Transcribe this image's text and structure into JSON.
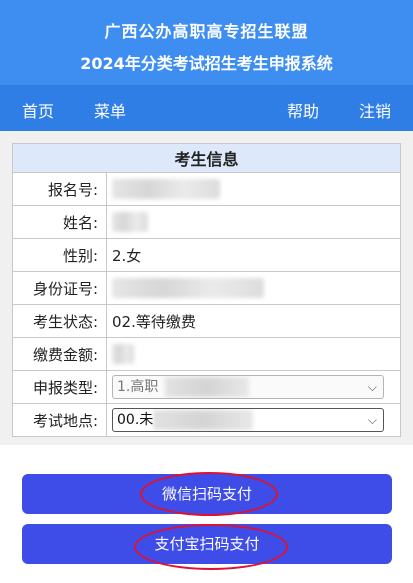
{
  "header": {
    "title_line1": "广西公办高职高专招生联盟",
    "title_line2": "2024年分类考试招生考生申报系统"
  },
  "nav": {
    "home": "首页",
    "menu": "菜单",
    "help": "帮助",
    "logout": "注销"
  },
  "info": {
    "title": "考生信息",
    "reg_no_label": "报名号:",
    "name_label": "姓名:",
    "gender_label": "性别:",
    "gender_value": "2.女",
    "id_label": "身份证号:",
    "status_label": "考生状态:",
    "status_value": "02.等待缴费",
    "fee_label": "缴费金额:",
    "apply_type_label": "申报类型:",
    "apply_type_value": "1.高职",
    "exam_site_label": "考试地点:",
    "exam_site_value": "00.未"
  },
  "buttons": {
    "wechat_pay": "微信扫码支付",
    "alipay": "支付宝扫码支付"
  },
  "colors": {
    "header_bg": "#3d8ef0",
    "nav_bg": "#2f7ee6",
    "button_bg": "#3f4de8",
    "highlight_circle": "#e0112e"
  }
}
